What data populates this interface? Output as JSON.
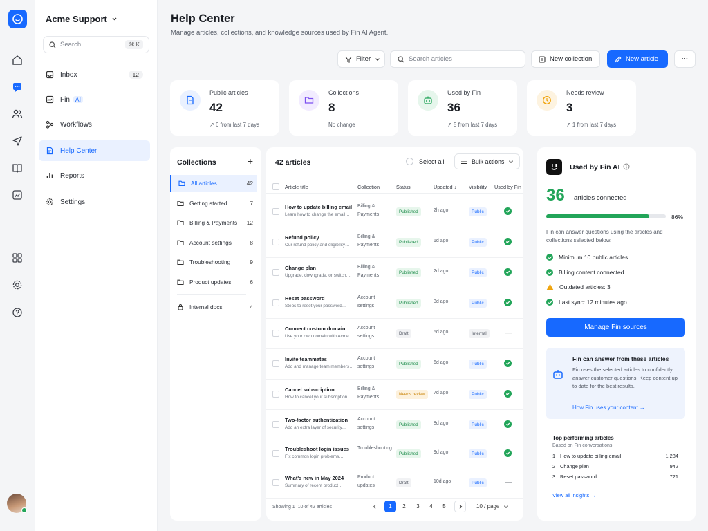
{
  "workspace": {
    "name": "Acme Support"
  },
  "search": {
    "placeholder": "Search",
    "shortcut": "⌘ K"
  },
  "nav": {
    "inbox": "Inbox",
    "inbox_count": "12",
    "fin": "Fin",
    "fin_badge": "AI",
    "workflows": "Workflows",
    "help_center": "Help Center",
    "reports": "Reports",
    "settings": "Settings"
  },
  "header": {
    "title": "Help Center",
    "subtitle": "Manage articles, collections, and knowledge sources used by Fin AI Agent."
  },
  "toolbar": {
    "filter": "Filter",
    "search_placeholder": "Search articles",
    "new_collection": "New collection",
    "new_article": "New article",
    "more": "···"
  },
  "stats": [
    {
      "label": "Public articles",
      "value": "42",
      "change": "↗ 6 from last 7 days"
    },
    {
      "label": "Collections",
      "value": "8",
      "change": "No change"
    },
    {
      "label": "Used by Fin",
      "value": "36",
      "change": "↗ 5 from last 7 days"
    },
    {
      "label": "Needs review",
      "value": "3",
      "change": "↗ 1 from last 7 days"
    }
  ],
  "collections": {
    "title": "Collections",
    "add": "+",
    "items": [
      {
        "name": "All articles",
        "count": "42"
      },
      {
        "name": "Getting started",
        "count": "7"
      },
      {
        "name": "Billing & Payments",
        "count": "12"
      },
      {
        "name": "Account settings",
        "count": "8"
      },
      {
        "name": "Troubleshooting",
        "count": "9"
      },
      {
        "name": "Product updates",
        "count": "6"
      },
      {
        "name": "Internal docs",
        "count": "4"
      }
    ]
  },
  "table": {
    "count": "42 articles",
    "select_all": "Select all",
    "bulk_actions": "Bulk actions",
    "headers": {
      "title": "Article title",
      "collection": "Collection",
      "status": "Status",
      "updated": "Updated ↓",
      "visibility": "Visibility",
      "fin": "Used by Fin"
    },
    "rows": [
      {
        "title": "How to update billing email",
        "desc": "Learn how to change the email…",
        "collection": "Billing & Payments",
        "status": "Published",
        "updated": "2h ago",
        "visibility": "Public",
        "fin": true
      },
      {
        "title": "Refund policy",
        "desc": "Our refund policy and eligibility…",
        "collection": "Billing & Payments",
        "status": "Published",
        "updated": "1d ago",
        "visibility": "Public",
        "fin": true
      },
      {
        "title": "Change plan",
        "desc": "Upgrade, downgrade, or switch…",
        "collection": "Billing & Payments",
        "status": "Published",
        "updated": "2d ago",
        "visibility": "Public",
        "fin": true
      },
      {
        "title": "Reset password",
        "desc": "Steps to reset your password…",
        "collection": "Account settings",
        "status": "Published",
        "updated": "3d ago",
        "visibility": "Public",
        "fin": true
      },
      {
        "title": "Connect custom domain",
        "desc": "Use your own domain with Acme…",
        "collection": "Account settings",
        "status": "Draft",
        "updated": "5d ago",
        "visibility": "Internal",
        "fin": false
      },
      {
        "title": "Invite teammates",
        "desc": "Add and manage team members…",
        "collection": "Account settings",
        "status": "Published",
        "updated": "6d ago",
        "visibility": "Public",
        "fin": true
      },
      {
        "title": "Cancel subscription",
        "desc": "How to cancel your subscription…",
        "collection": "Billing & Payments",
        "status": "Needs review",
        "updated": "7d ago",
        "visibility": "Public",
        "fin": true
      },
      {
        "title": "Two-factor authentication",
        "desc": "Add an extra layer of security…",
        "collection": "Account settings",
        "status": "Published",
        "updated": "8d ago",
        "visibility": "Public",
        "fin": true
      },
      {
        "title": "Troubleshoot login issues",
        "desc": "Fix common login problems…",
        "collection": "Troubleshooting",
        "status": "Published",
        "updated": "9d ago",
        "visibility": "Public",
        "fin": true
      },
      {
        "title": "What's new in May 2024",
        "desc": "Summary of recent product…",
        "collection": "Product updates",
        "status": "Draft",
        "updated": "10d ago",
        "visibility": "Public",
        "fin": false
      }
    ],
    "showing": "Showing 1–10 of 42 articles",
    "pages": [
      "1",
      "2",
      "3",
      "4",
      "5"
    ],
    "per_page": "10 / page"
  },
  "fin_panel": {
    "title": "Used by Fin AI",
    "connected_count": "36",
    "connected_label": "articles connected",
    "progress": 0.86,
    "progress_label": "86%",
    "desc": "Fin can answer questions using the articles and collections selected below.",
    "checks": [
      {
        "text": "Minimum 10 public articles",
        "kind": "ok"
      },
      {
        "text": "Billing content connected",
        "kind": "ok"
      },
      {
        "text": "Outdated articles: 3",
        "kind": "warn"
      },
      {
        "text": "Last sync: 12 minutes ago",
        "kind": "ok"
      }
    ],
    "manage": "Manage Fin sources",
    "info_title": "Fin can answer from these articles",
    "info_body": "Fin uses the selected articles to confidently answer customer questions. Keep content up to date for the best results.",
    "info_link": "How Fin uses your content →",
    "top_title": "Top performing articles",
    "top_sub": "Based on Fin conversations",
    "top": [
      {
        "rank": "1",
        "name": "How to update billing email",
        "count": "1,284"
      },
      {
        "rank": "2",
        "name": "Change plan",
        "count": "942"
      },
      {
        "rank": "3",
        "name": "Reset password",
        "count": "721"
      }
    ],
    "view_all": "View all insights →"
  },
  "colors": {
    "accent": "#1769ff",
    "success": "#22a559",
    "warning": "#f0a30a"
  }
}
